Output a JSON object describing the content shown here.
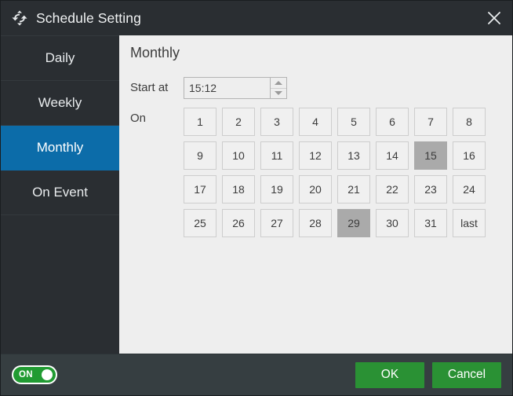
{
  "window": {
    "title": "Schedule Setting",
    "icon": "sync-arrows-icon",
    "close_icon": "close-icon"
  },
  "sidebar": {
    "items": [
      {
        "label": "Daily",
        "active": false
      },
      {
        "label": "Weekly",
        "active": false
      },
      {
        "label": "Monthly",
        "active": true
      },
      {
        "label": "On Event",
        "active": false
      }
    ]
  },
  "panel": {
    "title": "Monthly",
    "start_at": {
      "label": "Start at",
      "value": "15:12",
      "placeholder": "HH:mm",
      "spin_up_icon": "chevron-up-icon",
      "spin_down_icon": "chevron-down-icon"
    },
    "on": {
      "label": "On",
      "days": [
        {
          "label": "1",
          "selected": false
        },
        {
          "label": "2",
          "selected": false
        },
        {
          "label": "3",
          "selected": false
        },
        {
          "label": "4",
          "selected": false
        },
        {
          "label": "5",
          "selected": false
        },
        {
          "label": "6",
          "selected": false
        },
        {
          "label": "7",
          "selected": false
        },
        {
          "label": "8",
          "selected": false
        },
        {
          "label": "9",
          "selected": false
        },
        {
          "label": "10",
          "selected": false
        },
        {
          "label": "11",
          "selected": false
        },
        {
          "label": "12",
          "selected": false
        },
        {
          "label": "13",
          "selected": false
        },
        {
          "label": "14",
          "selected": false
        },
        {
          "label": "15",
          "selected": true
        },
        {
          "label": "16",
          "selected": false
        },
        {
          "label": "17",
          "selected": false
        },
        {
          "label": "18",
          "selected": false
        },
        {
          "label": "19",
          "selected": false
        },
        {
          "label": "20",
          "selected": false
        },
        {
          "label": "21",
          "selected": false
        },
        {
          "label": "22",
          "selected": false
        },
        {
          "label": "23",
          "selected": false
        },
        {
          "label": "24",
          "selected": false
        },
        {
          "label": "25",
          "selected": false
        },
        {
          "label": "26",
          "selected": false
        },
        {
          "label": "27",
          "selected": false
        },
        {
          "label": "28",
          "selected": false
        },
        {
          "label": "29",
          "selected": true
        },
        {
          "label": "30",
          "selected": false
        },
        {
          "label": "31",
          "selected": false
        },
        {
          "label": "last",
          "selected": false
        }
      ]
    }
  },
  "footer": {
    "toggle": {
      "label": "ON",
      "state": "on"
    },
    "ok_label": "OK",
    "cancel_label": "Cancel"
  },
  "colors": {
    "accent_blue": "#0c6ca9",
    "accent_green": "#2a9134",
    "chrome_dark": "#2a2e32",
    "footer_dark": "#363e41",
    "panel_bg": "#eeeeee",
    "selected_day": "#aaaaaa"
  }
}
